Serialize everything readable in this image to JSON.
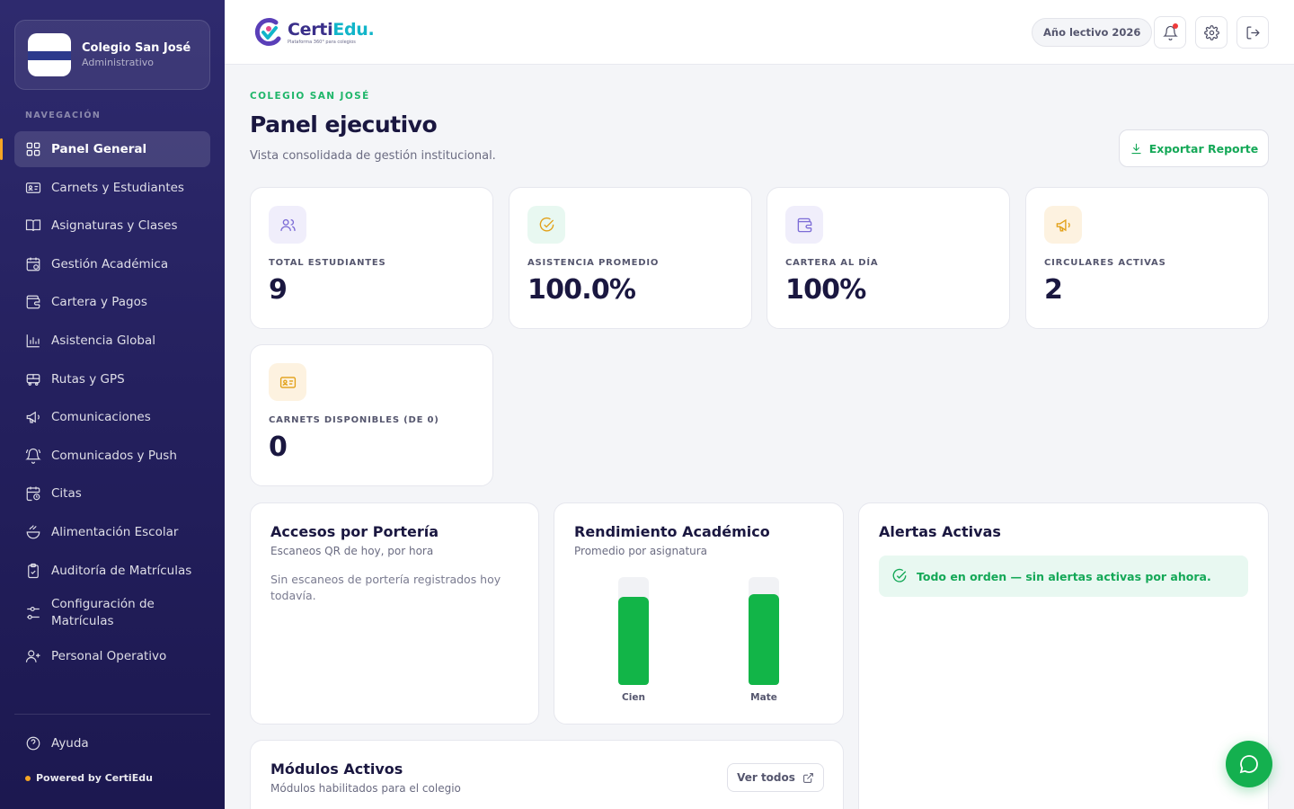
{
  "sidebar": {
    "school_name": "Colegio San José",
    "school_role": "Administrativo",
    "nav_heading": "NAVEGACIÓN",
    "items": [
      {
        "label": "Panel General",
        "icon": "grid-icon"
      },
      {
        "label": "Carnets y Estudiantes",
        "icon": "id-card-icon"
      },
      {
        "label": "Asignaturas y Clases",
        "icon": "book-icon"
      },
      {
        "label": "Gestión Académica",
        "icon": "calendar-icon"
      },
      {
        "label": "Cartera y Pagos",
        "icon": "wallet-icon"
      },
      {
        "label": "Asistencia Global",
        "icon": "bar-chart-icon"
      },
      {
        "label": "Rutas y GPS",
        "icon": "bus-icon"
      },
      {
        "label": "Comunicaciones",
        "icon": "megaphone-icon"
      },
      {
        "label": "Comunicados y Push",
        "icon": "bell-ring-icon"
      },
      {
        "label": "Citas",
        "icon": "calendar-clock-icon"
      },
      {
        "label": "Alimentación Escolar",
        "icon": "food-icon"
      },
      {
        "label": "Auditoría de Matrículas",
        "icon": "clipboard-check-icon"
      },
      {
        "label": "Configuración de Matrículas",
        "icon": "settings-sliders-icon"
      },
      {
        "label": "Personal Operativo",
        "icon": "user-plus-icon"
      }
    ],
    "help_label": "Ayuda",
    "powered_by": "Powered by CertiEdu"
  },
  "topbar": {
    "brand_name_main": "Certi",
    "brand_name_accent": "Edu.",
    "brand_tagline": "Plataforma 360° para colegios",
    "school_year": "Año lectivo 2026"
  },
  "header": {
    "eyebrow": "COLEGIO SAN JOSÉ",
    "title": "Panel ejecutivo",
    "subtitle": "Vista consolidada de gestión institucional.",
    "export_label": "Exportar Reporte"
  },
  "stats": [
    {
      "label": "TOTAL ESTUDIANTES",
      "value": "9",
      "icon": "users-icon",
      "color": "#7c6cd6",
      "bg": "#f0eefb"
    },
    {
      "label": "ASISTENCIA PROMEDIO",
      "value": "100.0%",
      "icon": "check-circle-icon",
      "color": "#e2a017",
      "bg": "#e8f8f1"
    },
    {
      "label": "CARTERA AL DÍA",
      "value": "100%",
      "icon": "wallet-icon",
      "color": "#7c6cd6",
      "bg": "#f0eefb"
    },
    {
      "label": "CIRCULARES ACTIVAS",
      "value": "2",
      "icon": "megaphone-icon",
      "color": "#e2a017",
      "bg": "#fdf2e0"
    },
    {
      "label": "CARNETS DISPONIBLES (DE 0)",
      "value": "0",
      "icon": "id-card-icon",
      "color": "#e2a017",
      "bg": "#fdf2e0"
    }
  ],
  "accesos": {
    "title": "Accesos por Portería",
    "subtitle": "Escaneos QR de hoy, por hora",
    "empty": "Sin escaneos de portería registrados hoy todavía."
  },
  "rendimiento": {
    "title": "Rendimiento Académico",
    "subtitle": "Promedio por asignatura"
  },
  "chart_data": {
    "type": "bar",
    "categories": [
      "Cien",
      "Mate"
    ],
    "values": [
      0.82,
      0.84
    ],
    "ylim": [
      0,
      1
    ],
    "grid": false,
    "color": "#12b548"
  },
  "alertas": {
    "title": "Alertas Activas",
    "ok_message": "Todo en orden — sin alertas activas por ahora."
  },
  "modulos": {
    "title": "Módulos Activos",
    "subtitle": "Módulos habilitados para el colegio",
    "view_all": "Ver todos"
  },
  "colors": {
    "accent_green": "#14a857",
    "sidebar_bg": "#2a2668",
    "active_marker": "#f5a524"
  }
}
